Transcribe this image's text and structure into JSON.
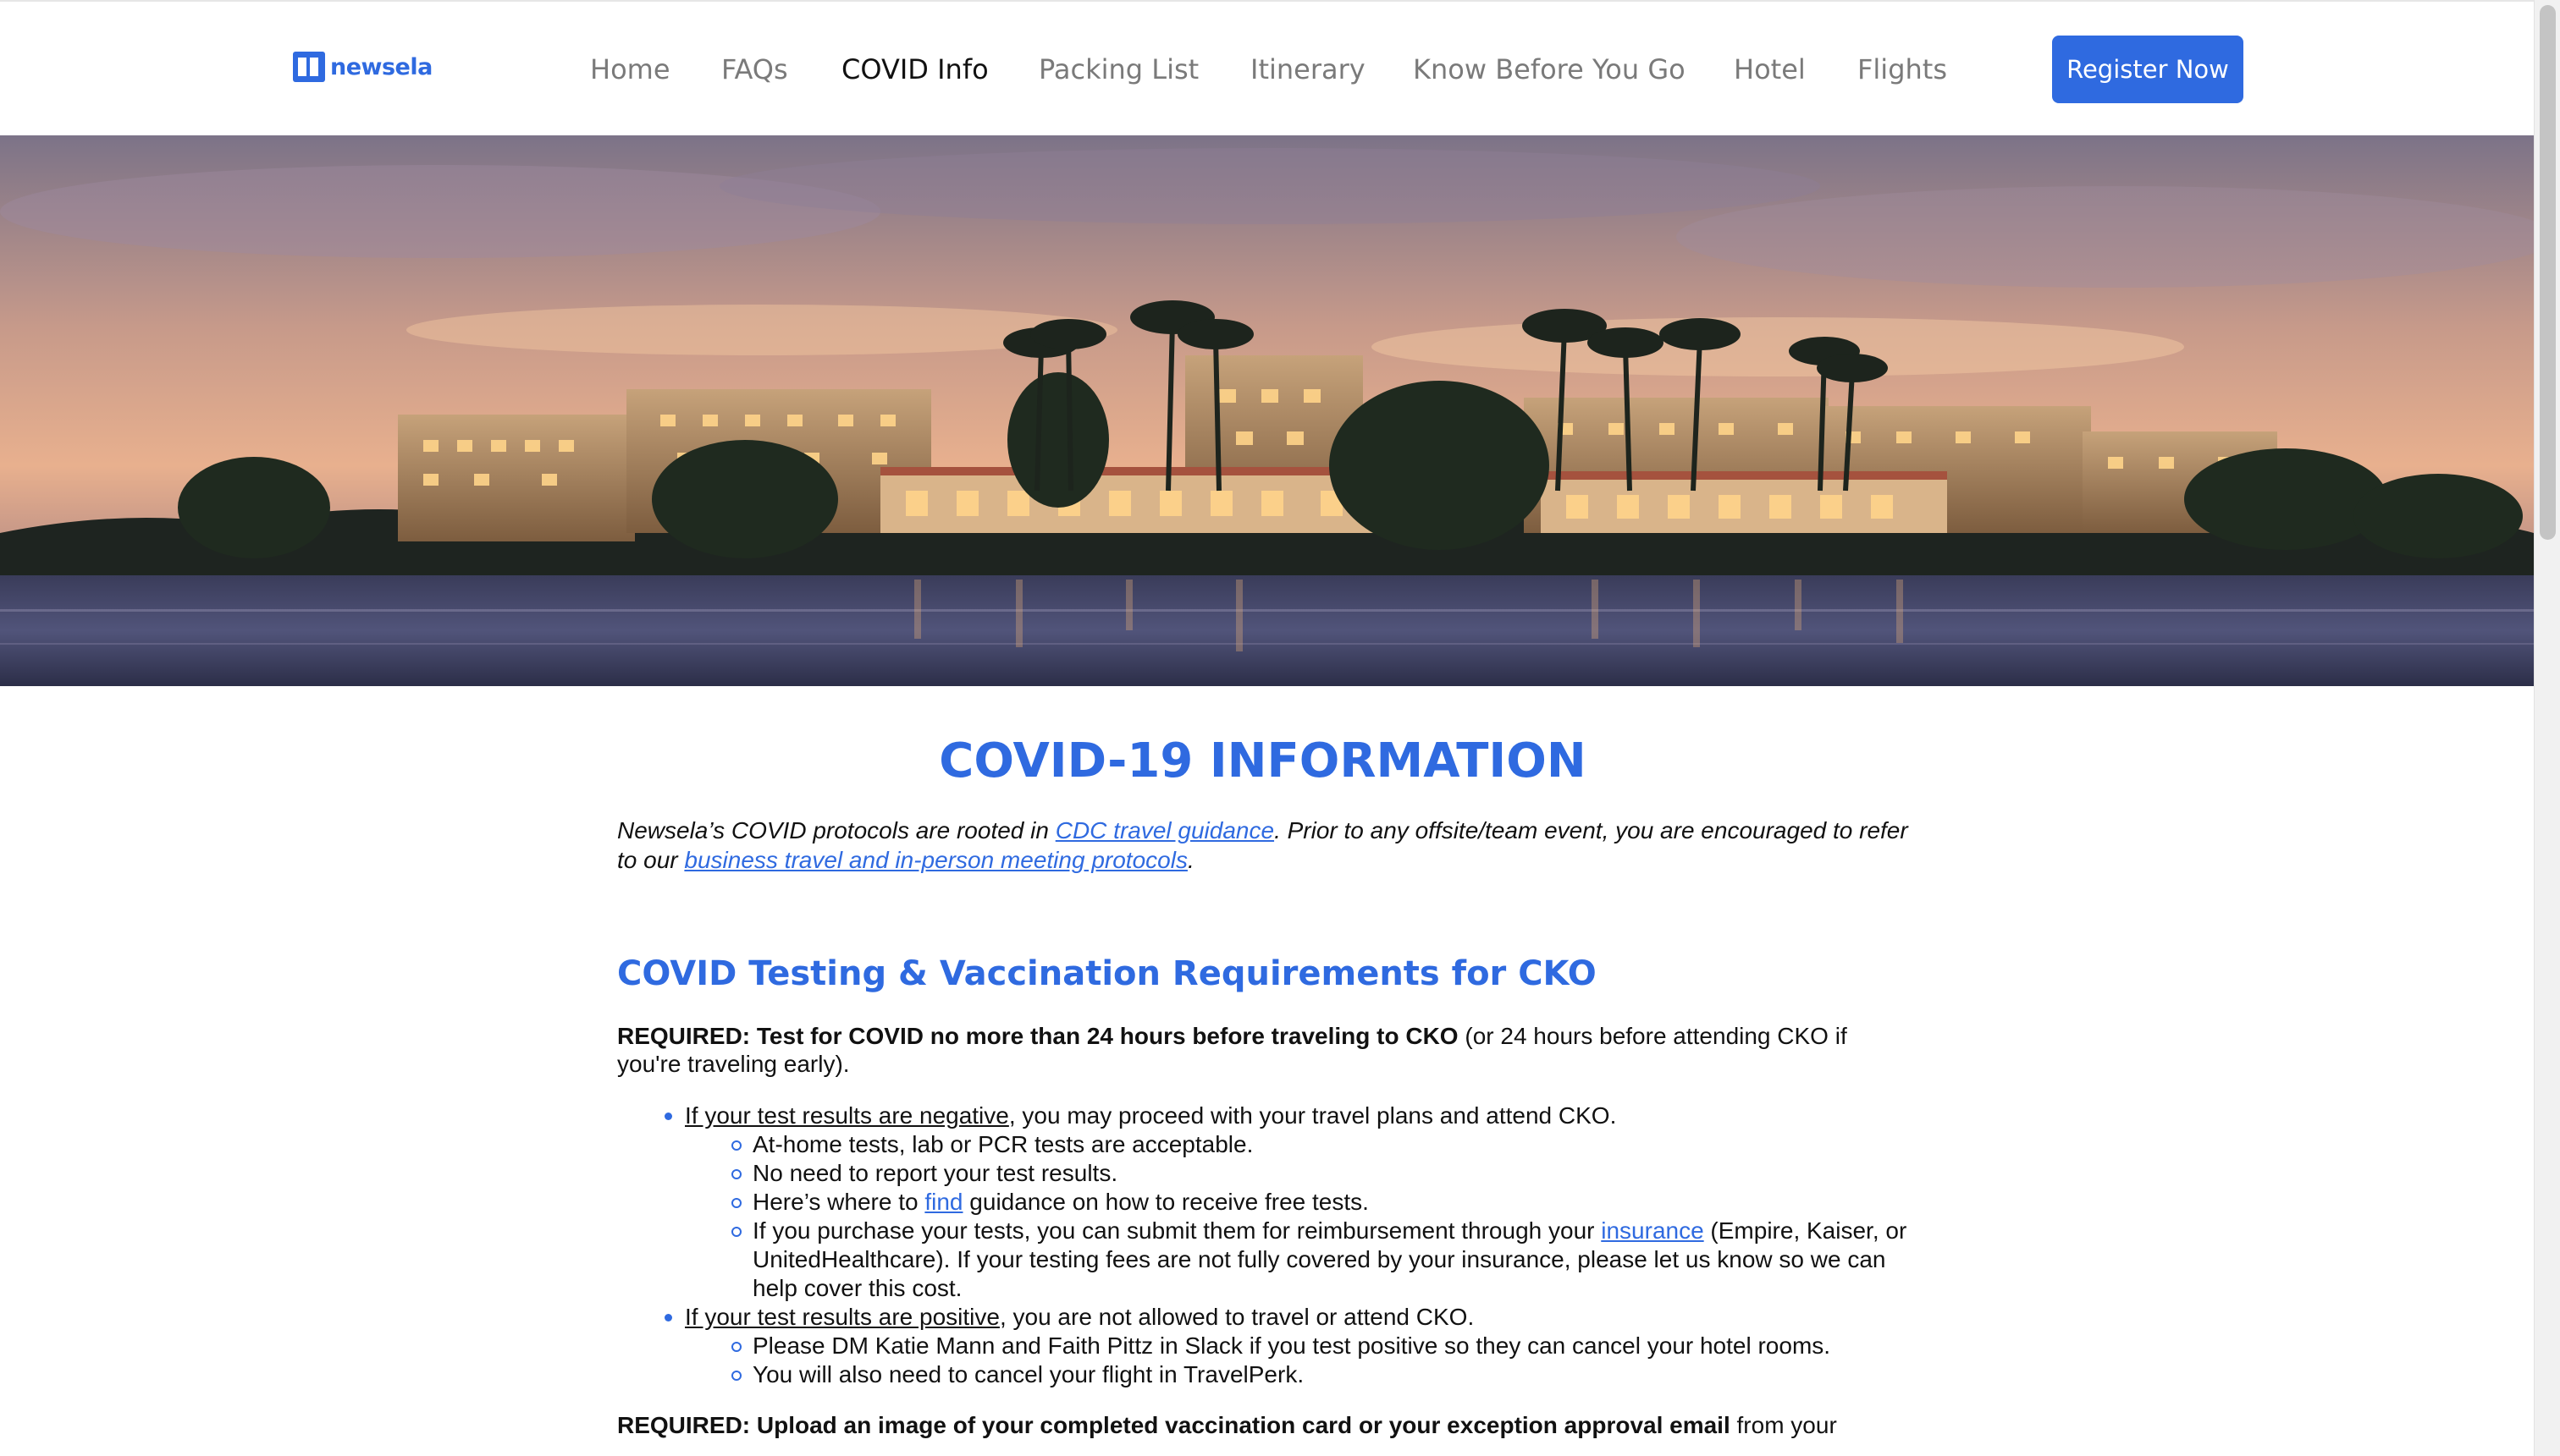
{
  "brand": {
    "name": "newsela"
  },
  "nav": {
    "items": [
      {
        "label": "Home"
      },
      {
        "label": "FAQs"
      },
      {
        "label": "COVID Info",
        "active": true
      },
      {
        "label": "Packing List"
      },
      {
        "label": "Itinerary"
      },
      {
        "label": "Know Before You Go"
      },
      {
        "label": "Hotel"
      },
      {
        "label": "Flights"
      }
    ],
    "cta_label": "Register Now"
  },
  "colors": {
    "accent": "#2f6ae0",
    "text": "#111111",
    "nav_text": "#7a7a7a"
  },
  "hero": {
    "alt": "resort-at-dusk-photo"
  },
  "main": {
    "title": "COVID-19 INFORMATION",
    "intro": {
      "part1": "Newsela’s COVID protocols are rooted in ",
      "link1": "CDC travel guidance",
      "part2": ". Prior to any offsite/team event, you are encouraged to refer to our ",
      "link2": "business travel and in-person meeting protocols",
      "part3": "."
    },
    "section_title": "COVID Testing & Vaccination Requirements for CKO",
    "requirement1": {
      "bold": "REQUIRED: Test for COVID no more than 24 hours before traveling to CKO",
      "rest": " (or 24 hours before attending CKO if you're traveling early)."
    },
    "negative": {
      "lead": "If your test results are negative",
      "rest": ", you may proceed with your travel plans and attend CKO.",
      "items": [
        "At-home tests, lab or PCR tests are acceptable.",
        "No need to report your test results."
      ],
      "find_pre": "Here’s where to ",
      "find_link": "find",
      "find_post": " guidance on how to receive free tests.",
      "ins_pre": "If you purchase your tests, you can submit them for reimbursement through your ",
      "ins_link": "insurance",
      "ins_post": " (Empire, Kaiser, or UnitedHealthcare). If your testing fees are not fully covered by your insurance, please let us know so we can help cover this cost."
    },
    "positive": {
      "lead": "If your test results are positive",
      "rest": ", you are not allowed to travel or attend CKO.",
      "items": [
        "Please DM Katie Mann and Faith Pittz in Slack if you test positive so they can cancel your hotel rooms.",
        "You will also need to cancel your flight in TravelPerk."
      ]
    },
    "requirement2": {
      "bold": "REQUIRED: Upload an image of your completed vaccination card or your exception approval email",
      "rest": " from your"
    }
  }
}
